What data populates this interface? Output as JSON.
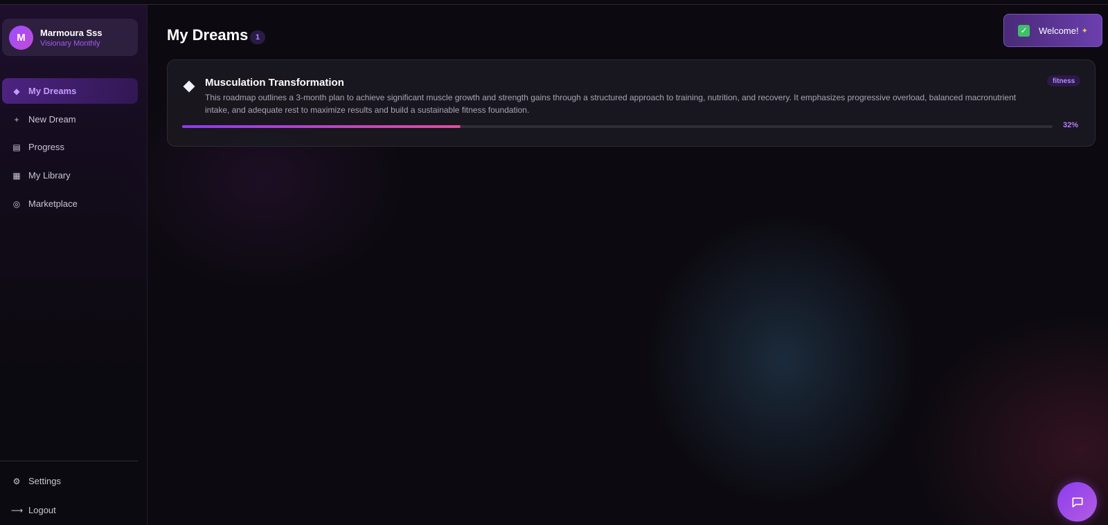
{
  "profile": {
    "initial": "M",
    "name": "Marmoura Sss",
    "plan": "Visionary Monthly"
  },
  "sidebar": {
    "items": [
      {
        "label": "My Dreams",
        "icon": "diamond-icon",
        "active": true
      },
      {
        "label": "New Dream",
        "icon": "plus-icon",
        "active": false
      },
      {
        "label": "Progress",
        "icon": "list-icon",
        "active": false
      },
      {
        "label": "My Library",
        "icon": "grid-icon",
        "active": false
      },
      {
        "label": "Marketplace",
        "icon": "target-icon",
        "active": false
      }
    ],
    "bottom": [
      {
        "label": "Settings",
        "icon": "gear-icon"
      },
      {
        "label": "Logout",
        "icon": "arrow-right-icon"
      }
    ]
  },
  "main": {
    "title": "My Dreams",
    "count": "1",
    "dreams": [
      {
        "title": "Musculation Transformation",
        "description": "This roadmap outlines a 3-month plan to achieve significant muscle growth and strength gains through a structured approach to training, nutrition, and recovery. It emphasizes progressive overload, balanced macronutrient intake, and adequate rest to maximize results and build a sustainable fitness foundation.",
        "tag": "fitness",
        "progress": 0.32,
        "progress_label": "32%"
      }
    ]
  },
  "toast": {
    "text": "Welcome!",
    "icon": "check-icon",
    "emoji_icon": "party-icon"
  },
  "chat": {
    "icon": "chat-bubble-icon"
  },
  "colors": {
    "accent": "#a25bf0",
    "progress_start": "#8b3bf0",
    "progress_end": "#e04f9c",
    "background": "#0c0a10"
  }
}
